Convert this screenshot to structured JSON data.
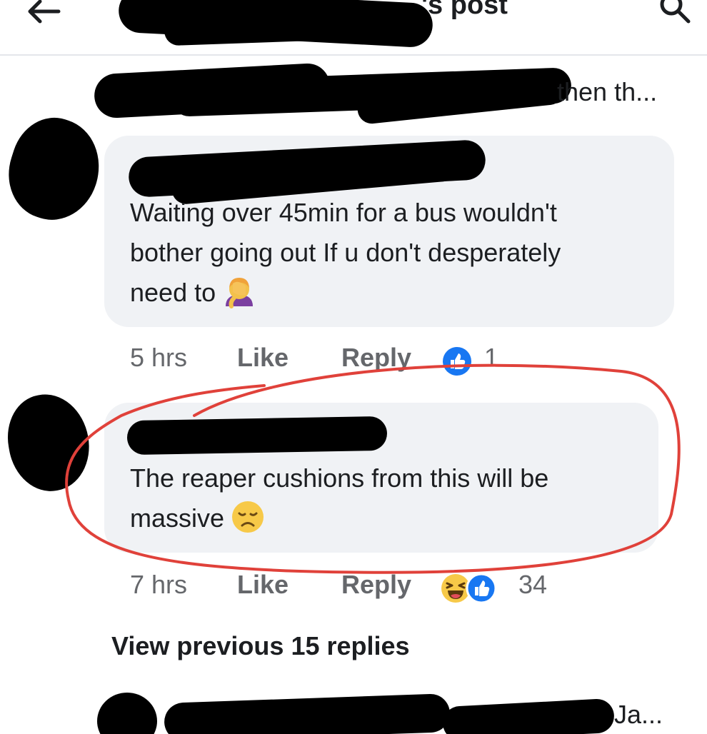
{
  "header": {
    "title_fragment": "'s post",
    "back_icon": "arrow-left-icon",
    "search_icon": "search-icon"
  },
  "context": {
    "text_fragment": "then th..."
  },
  "comments": [
    {
      "text_line1": "Waiting over 45min for a bus wouldn't",
      "text_line2": "bother going out If u don't desperately",
      "text_line3": "need to",
      "emoji": "woman-facepalming-emoji",
      "time": "5 hrs",
      "like_label": "Like",
      "reply_label": "Reply",
      "reaction_icon": "like-reaction-icon",
      "reaction_count": "1"
    },
    {
      "text_line1": "The reaper cushions from this will be",
      "text_line2": "massive",
      "emoji": "disappointed-face-emoji",
      "time": "7 hrs",
      "like_label": "Like",
      "reply_label": "Reply",
      "reaction_icons": [
        "haha-reaction-icon",
        "like-reaction-icon"
      ],
      "reaction_count": "34"
    }
  ],
  "view_previous": "View previous 15 replies",
  "next_comment": {
    "text_fragment": "Ja..."
  },
  "colors": {
    "bubble": "#f0f2f5",
    "secondary_text": "#65676b",
    "like_blue": "#1877f2",
    "annotation_red": "#e0413a"
  }
}
